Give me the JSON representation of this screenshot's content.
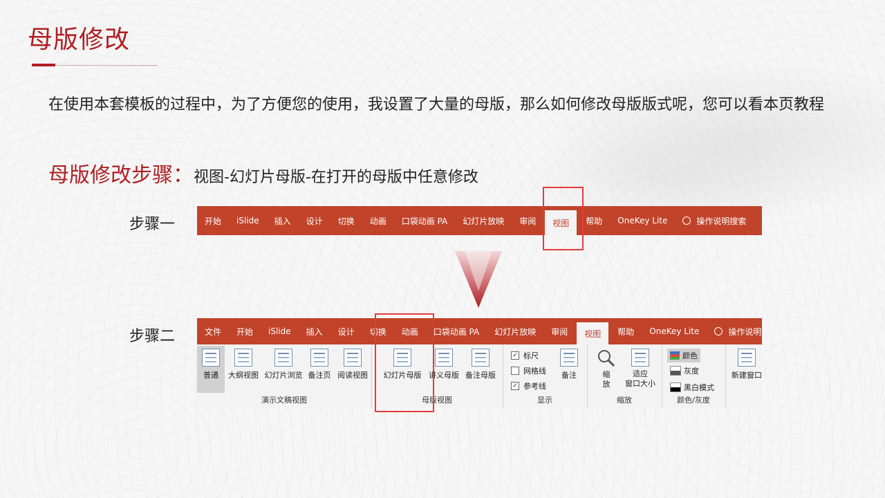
{
  "slide": {
    "title": "母版修改",
    "intro": "在使用本套模板的过程中，为了方便您的使用，我设置了大量的母版，那么如何修改母版版式呢，您可以看本页教程",
    "steps_heading": "母版修改步骤：",
    "steps_path": "视图-幻灯片母版-在打开的母版中任意修改",
    "step1_label": "步骤一",
    "step2_label": "步骤二"
  },
  "ribbon1": {
    "tabs": [
      "开始",
      "iSlide",
      "插入",
      "设计",
      "切换",
      "动画",
      "口袋动画 PA",
      "幻灯片放映",
      "审阅",
      "视图",
      "帮助",
      "OneKey Lite"
    ],
    "active_tab": "视图",
    "search": "操作说明搜索"
  },
  "ribbon2": {
    "tabs": [
      "文件",
      "开始",
      "iSlide",
      "插入",
      "设计",
      "切换",
      "动画",
      "口袋动画 PA",
      "幻灯片放映",
      "审阅",
      "视图",
      "帮助",
      "OneKey Lite"
    ],
    "active_tab": "视图",
    "search": "操作说明",
    "groups": {
      "presentation_views": {
        "label": "演示文稿视图",
        "buttons": [
          "普通",
          "大纲视图",
          "幻灯片浏览",
          "备注页",
          "阅读视图"
        ]
      },
      "master_views": {
        "label": "母版视图",
        "buttons": [
          "幻灯片母版",
          "讲义母版",
          "备注母版"
        ]
      },
      "show": {
        "label": "显示",
        "checks": [
          {
            "label": "标尺",
            "checked": true
          },
          {
            "label": "网格线",
            "checked": false
          },
          {
            "label": "参考线",
            "checked": true
          }
        ],
        "notes_button": "备注"
      },
      "zoom": {
        "label": "缩放",
        "zoom_button": "缩\n放",
        "fit_button_line1": "适应",
        "fit_button_line2": "窗口大小"
      },
      "color": {
        "label": "颜色/灰度",
        "items": [
          "颜色",
          "灰度",
          "黑白模式"
        ]
      },
      "window": {
        "new_window": "新建窗口"
      }
    }
  },
  "colors": {
    "accent_red": "#b01e23",
    "ribbon_orange": "#c0432a",
    "highlight_box": "#e63a3a"
  }
}
